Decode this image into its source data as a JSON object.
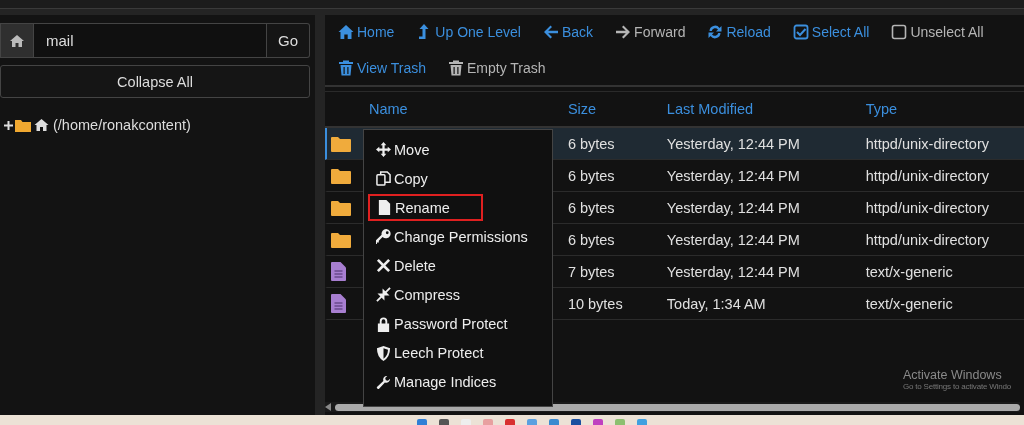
{
  "sidebar": {
    "path_field": {
      "value": "mail"
    },
    "go_button": "Go",
    "collapse_button": "Collapse All",
    "tree": [
      {
        "label": "(/home/ronakcontent)",
        "expanded": false
      }
    ]
  },
  "toolbar": [
    {
      "label": "Home",
      "disabled": false
    },
    {
      "label": "Up One Level",
      "disabled": false
    },
    {
      "label": "Back",
      "disabled": false
    },
    {
      "label": "Forward",
      "disabled": true
    },
    {
      "label": "Reload",
      "disabled": false
    },
    {
      "label": "Select All",
      "disabled": false
    },
    {
      "label": "Unselect All",
      "disabled": true
    },
    {
      "label": "View Trash",
      "disabled": false
    },
    {
      "label": "Empty Trash",
      "disabled": true
    }
  ],
  "table": {
    "columns": [
      "Name",
      "Size",
      "Last Modified",
      "Type"
    ],
    "rows": [
      {
        "kind": "folder",
        "selected": true,
        "size": "6 bytes",
        "modified": "Yesterday, 12:44 PM",
        "type": "httpd/unix-directory"
      },
      {
        "kind": "folder",
        "selected": false,
        "size": "6 bytes",
        "modified": "Yesterday, 12:44 PM",
        "type": "httpd/unix-directory"
      },
      {
        "kind": "folder",
        "selected": false,
        "size": "6 bytes",
        "modified": "Yesterday, 12:44 PM",
        "type": "httpd/unix-directory"
      },
      {
        "kind": "folder",
        "selected": false,
        "size": "6 bytes",
        "modified": "Yesterday, 12:44 PM",
        "type": "httpd/unix-directory"
      },
      {
        "kind": "file",
        "selected": false,
        "size": "7 bytes",
        "modified": "Yesterday, 12:44 PM",
        "type": "text/x-generic"
      },
      {
        "kind": "file",
        "selected": false,
        "size": "10 bytes",
        "modified": "Today, 1:34 AM",
        "type": "text/x-generic"
      }
    ]
  },
  "context_menu": [
    {
      "label": "Move",
      "outlined": false
    },
    {
      "label": "Copy",
      "outlined": false
    },
    {
      "label": "Rename",
      "outlined": true
    },
    {
      "label": "Change Permissions",
      "outlined": false
    },
    {
      "label": "Delete",
      "outlined": false
    },
    {
      "label": "Compress",
      "outlined": false
    },
    {
      "label": "Password Protect",
      "outlined": false
    },
    {
      "label": "Leech Protect",
      "outlined": false
    },
    {
      "label": "Manage Indices",
      "outlined": false
    }
  ],
  "activation_notice": {
    "title": "Activate Windows",
    "subtitle": "Go to Settings to activate Windo"
  }
}
